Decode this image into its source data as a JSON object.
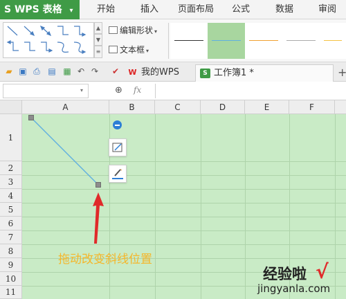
{
  "app": {
    "name": "WPS 表格"
  },
  "menu": [
    "开始",
    "插入",
    "页面布局",
    "公式",
    "数据",
    "审阅"
  ],
  "ribbon": {
    "edit_shape": "编辑形状",
    "text_box": "文本框"
  },
  "tabs": {
    "wps": "我的WPS",
    "book": "工作簿1 *"
  },
  "formula_bar": {
    "name_box": "",
    "fx": "fx",
    "value": ""
  },
  "columns": [
    "A",
    "B",
    "C",
    "D",
    "E",
    "F"
  ],
  "rows": [
    "1",
    "2",
    "3",
    "4",
    "5",
    "6",
    "7",
    "8",
    "9",
    "10",
    "11"
  ],
  "annotation": "拖动改变斜线位置",
  "watermark": {
    "line1": "经验啦",
    "line2": "jingyanla.com"
  },
  "colors": {
    "accent": "#3f9b46",
    "sheet_fill": "#c9ebc6",
    "line": "#5fb0e0",
    "annotation": "#f5b62a",
    "arrow": "#e02a2a"
  },
  "icons": [
    "sheet-logo-icon",
    "open-folder-icon",
    "save-icon",
    "print-icon",
    "print-preview-icon",
    "undo-icon",
    "redo-icon",
    "format-painter-icon",
    "zoom-icon",
    "edit-shape-icon",
    "text-box-icon",
    "collapse-icon",
    "shape-style-icon",
    "shape-fill-icon",
    "checkmark-icon"
  ]
}
